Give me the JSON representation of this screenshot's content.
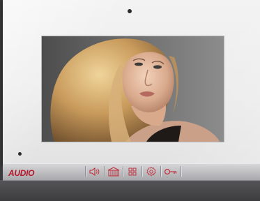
{
  "brand": {
    "logo_text": "UDIO",
    "logo_initial": "A",
    "logo_color": "#b3172a"
  },
  "screen": {
    "content": "camera-video-feed"
  },
  "toolbar": {
    "buttons": [
      {
        "icon": "speaker-icon"
      },
      {
        "icon": "door-gate-icon"
      },
      {
        "icon": "menu-grid-icon"
      },
      {
        "icon": "settings-gear-icon"
      },
      {
        "icon": "key-unlock-icon"
      }
    ],
    "icon_color": "#c0323f"
  }
}
